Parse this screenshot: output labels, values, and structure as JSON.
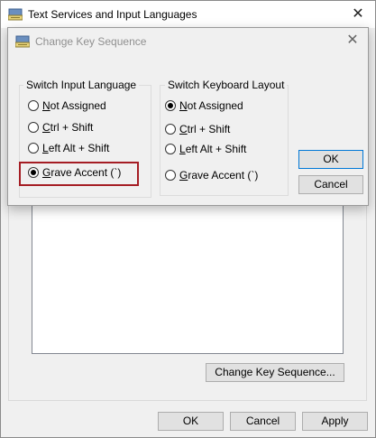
{
  "outer_window": {
    "title": "Text Services and Input Languages",
    "close_glyph": "✕",
    "change_key_sequence_button": "Change Key Sequence...",
    "buttons": {
      "ok": "OK",
      "cancel": "Cancel",
      "apply": "Apply"
    }
  },
  "dialog": {
    "title": "Change Key Sequence",
    "close_glyph": "✕",
    "switch_input_language": {
      "label": "Switch Input Language",
      "selected": "Grave Accent (`)",
      "options": [
        {
          "mnemonic": "N",
          "rest": "ot Assigned",
          "checked": false
        },
        {
          "mnemonic": "C",
          "rest": "trl + Shift",
          "checked": false
        },
        {
          "mnemonic": "L",
          "rest": "eft Alt + Shift",
          "checked": false
        },
        {
          "mnemonic": "G",
          "rest": "rave Accent (`)",
          "checked": true
        }
      ]
    },
    "switch_keyboard_layout": {
      "label": "Switch Keyboard Layout",
      "selected": "Not Assigned",
      "options": [
        {
          "mnemonic": "N",
          "rest": "ot Assigned",
          "checked": true
        },
        {
          "mnemonic": "C",
          "rest": "trl + Shift",
          "checked": false
        },
        {
          "mnemonic": "L",
          "rest": "eft Alt + Shift",
          "checked": false
        },
        {
          "mnemonic": "G",
          "rest": "rave Accent (`)",
          "checked": false
        }
      ]
    },
    "buttons": {
      "ok": "OK",
      "cancel": "Cancel"
    }
  },
  "colors": {
    "highlight_border": "#a51d24",
    "default_button_border": "#0078d7",
    "window_background": "#f0f0f0"
  },
  "icons": {
    "app": "keyboard-icon",
    "close": "close-icon"
  }
}
